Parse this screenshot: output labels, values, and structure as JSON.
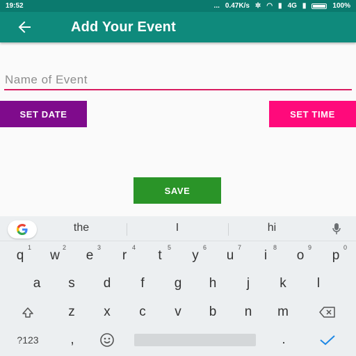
{
  "status_bar": {
    "time": "19:52",
    "dots": "...",
    "network_speed": "0.47K/s",
    "network_type": "4G",
    "volte": "VoLTE",
    "battery": "100%"
  },
  "app_bar": {
    "back_icon": "arrow-left",
    "title": "Add Your Event"
  },
  "form": {
    "name_placeholder": "Name of Event",
    "name_value": "",
    "set_date_label": "SET DATE",
    "set_time_label": "SET TIME",
    "save_label": "SAVE"
  },
  "colors": {
    "primary": "#0f8a7c",
    "primary_dark": "#0b7a6e",
    "accent_underline": "#d81b60",
    "set_date": "#7f0b8c",
    "set_time": "#ff0a7b",
    "save": "#2a9428"
  },
  "keyboard": {
    "suggestions": [
      "the",
      "I",
      "hi"
    ],
    "row1": [
      {
        "k": "q",
        "h": "1"
      },
      {
        "k": "w",
        "h": "2"
      },
      {
        "k": "e",
        "h": "3"
      },
      {
        "k": "r",
        "h": "4"
      },
      {
        "k": "t",
        "h": "5"
      },
      {
        "k": "y",
        "h": "6"
      },
      {
        "k": "u",
        "h": "7"
      },
      {
        "k": "i",
        "h": "8"
      },
      {
        "k": "o",
        "h": "9"
      },
      {
        "k": "p",
        "h": "0"
      }
    ],
    "row2": [
      "a",
      "s",
      "d",
      "f",
      "g",
      "h",
      "j",
      "k",
      "l"
    ],
    "row3": [
      "z",
      "x",
      "c",
      "v",
      "b",
      "n",
      "m"
    ],
    "symbols_label": "?123",
    "comma": ",",
    "period": "."
  }
}
